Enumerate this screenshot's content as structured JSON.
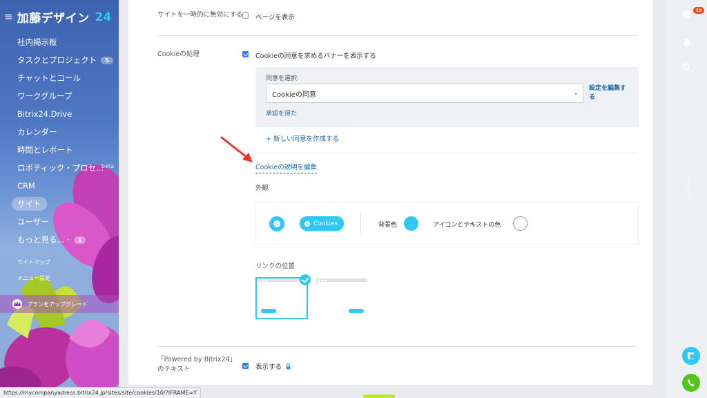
{
  "sidebar": {
    "logo": "加藤デザイン",
    "logo_num": "24",
    "items": [
      {
        "label": "社内掲示板",
        "name": "sidebar-item-feed"
      },
      {
        "label": "タスクとプロジェクト",
        "name": "sidebar-item-tasks",
        "count": "5"
      },
      {
        "label": "チャットとコール",
        "name": "sidebar-item-chat"
      },
      {
        "label": "ワークグループ",
        "name": "sidebar-item-workgroups"
      },
      {
        "label": "Bitrix24.Drive",
        "name": "sidebar-item-drive"
      },
      {
        "label": "カレンダー",
        "name": "sidebar-item-calendar"
      },
      {
        "label": "時間とレポート",
        "name": "sidebar-item-time-reports"
      },
      {
        "label": "ロボティック・プロセ...",
        "name": "sidebar-item-rpa",
        "beta": "beta"
      },
      {
        "label": "CRM",
        "name": "sidebar-item-crm"
      },
      {
        "label": "サイト",
        "name": "sidebar-item-sites",
        "active": true
      },
      {
        "label": "ユーザー",
        "name": "sidebar-item-users"
      },
      {
        "label": "もっと見る... ·",
        "name": "sidebar-item-more",
        "count": "1"
      }
    ],
    "sitemap": "サイトマップ",
    "menu_settings": "メニュー設定",
    "upgrade": "プランをアップグレード"
  },
  "settings": {
    "disable_site_label": "サイトを一時的に無効にする",
    "show_page_label": "ページを表示",
    "cookie_label": "Cookieの処理",
    "cookie_banner_label": "Cookieの同意を求めるバナーを表示する",
    "select_consent_label": "同意を選択:",
    "consent_value": "Cookieの同意",
    "edit_settings_link": "設定を編集する",
    "approved_link": "承認を得た",
    "new_consent_link": "+ 新しい同意を作成する",
    "edit_description_link": "Cookieの説明を編集",
    "appearance_label": "外観",
    "cookies_pill": "Cookies",
    "bg_color_label": "背景色",
    "icon_text_color_label": "アイコンとテキストの色",
    "link_position_label": "リンクの位置",
    "powered_by_label": "「Powered by Bitrix24」のテキスト",
    "show_label": "表示する"
  },
  "colors": {
    "accent": "#2fc7f7",
    "link": "#2067b0",
    "checkbox": "#2d7ef0",
    "icon_text_color": "#ffffff"
  },
  "rightpanel": {
    "notification_count": "19",
    "vertical_text": "オンライン"
  },
  "status_url": "https://mycompanyadress.bitrix24.jp/sites/site/cookies/10/?IFRAME=Y"
}
